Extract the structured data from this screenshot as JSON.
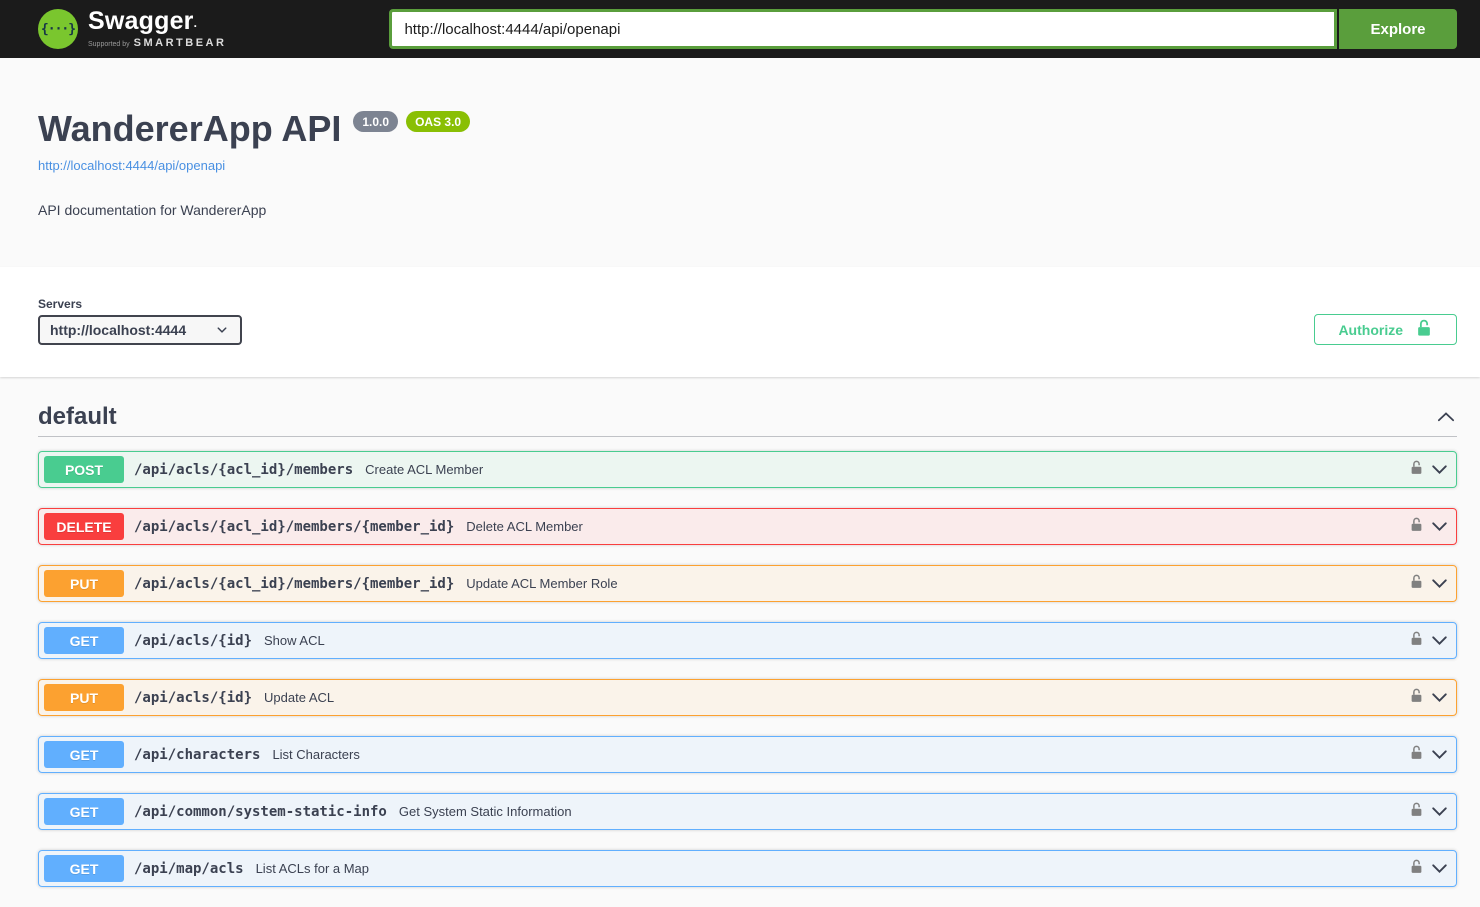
{
  "topbar": {
    "logo_title": "Swagger",
    "logo_mark": ".",
    "logo_glyph": "{···}",
    "logo_subtitle_prefix": "Supported by",
    "logo_subtitle_brand": "SMARTBEAR",
    "url_value": "http://localhost:4444/api/openapi",
    "explore_label": "Explore"
  },
  "info": {
    "title": "WandererApp API",
    "version_badge": "1.0.0",
    "oas_badge": "OAS 3.0",
    "spec_link": "http://localhost:4444/api/openapi",
    "description": "API documentation for WandererApp"
  },
  "scheme": {
    "servers_label": "Servers",
    "server_selected": "http://localhost:4444",
    "authorize_label": "Authorize"
  },
  "section": {
    "title": "default",
    "expanded": true
  },
  "operations": [
    {
      "method": "POST",
      "path": "/api/acls/{acl_id}/members",
      "summary": "Create ACL Member"
    },
    {
      "method": "DELETE",
      "path": "/api/acls/{acl_id}/members/{member_id}",
      "summary": "Delete ACL Member"
    },
    {
      "method": "PUT",
      "path": "/api/acls/{acl_id}/members/{member_id}",
      "summary": "Update ACL Member Role"
    },
    {
      "method": "GET",
      "path": "/api/acls/{id}",
      "summary": "Show ACL"
    },
    {
      "method": "PUT",
      "path": "/api/acls/{id}",
      "summary": "Update ACL"
    },
    {
      "method": "GET",
      "path": "/api/characters",
      "summary": "List Characters"
    },
    {
      "method": "GET",
      "path": "/api/common/system-static-info",
      "summary": "Get System Static Information"
    },
    {
      "method": "GET",
      "path": "/api/map/acls",
      "summary": "List ACLs for a Map"
    }
  ],
  "icons": {
    "logo": "swagger-braces-icon",
    "row_lock": "unlocked-padlock-icon",
    "authorize_lock": "unlocked-padlock-icon",
    "row_expand": "chevron-down-icon",
    "section_collapse": "chevron-up-icon",
    "server_dropdown": "chevron-down-icon"
  },
  "colors": {
    "topbar_bg": "#1b1b1b",
    "logo_green": "#7ac62e",
    "explore_green": "#5a9e3c",
    "authorize_green": "#49cc90",
    "version_badge_bg": "#7d8492",
    "oas_badge_bg": "#89bf04",
    "link_blue": "#4990e2",
    "text": "#3b4151",
    "page_bg": "#fafafa",
    "methods": {
      "GET": "#61affe",
      "POST": "#49cc90",
      "PUT": "#fca130",
      "DELETE": "#f93e3e"
    }
  }
}
